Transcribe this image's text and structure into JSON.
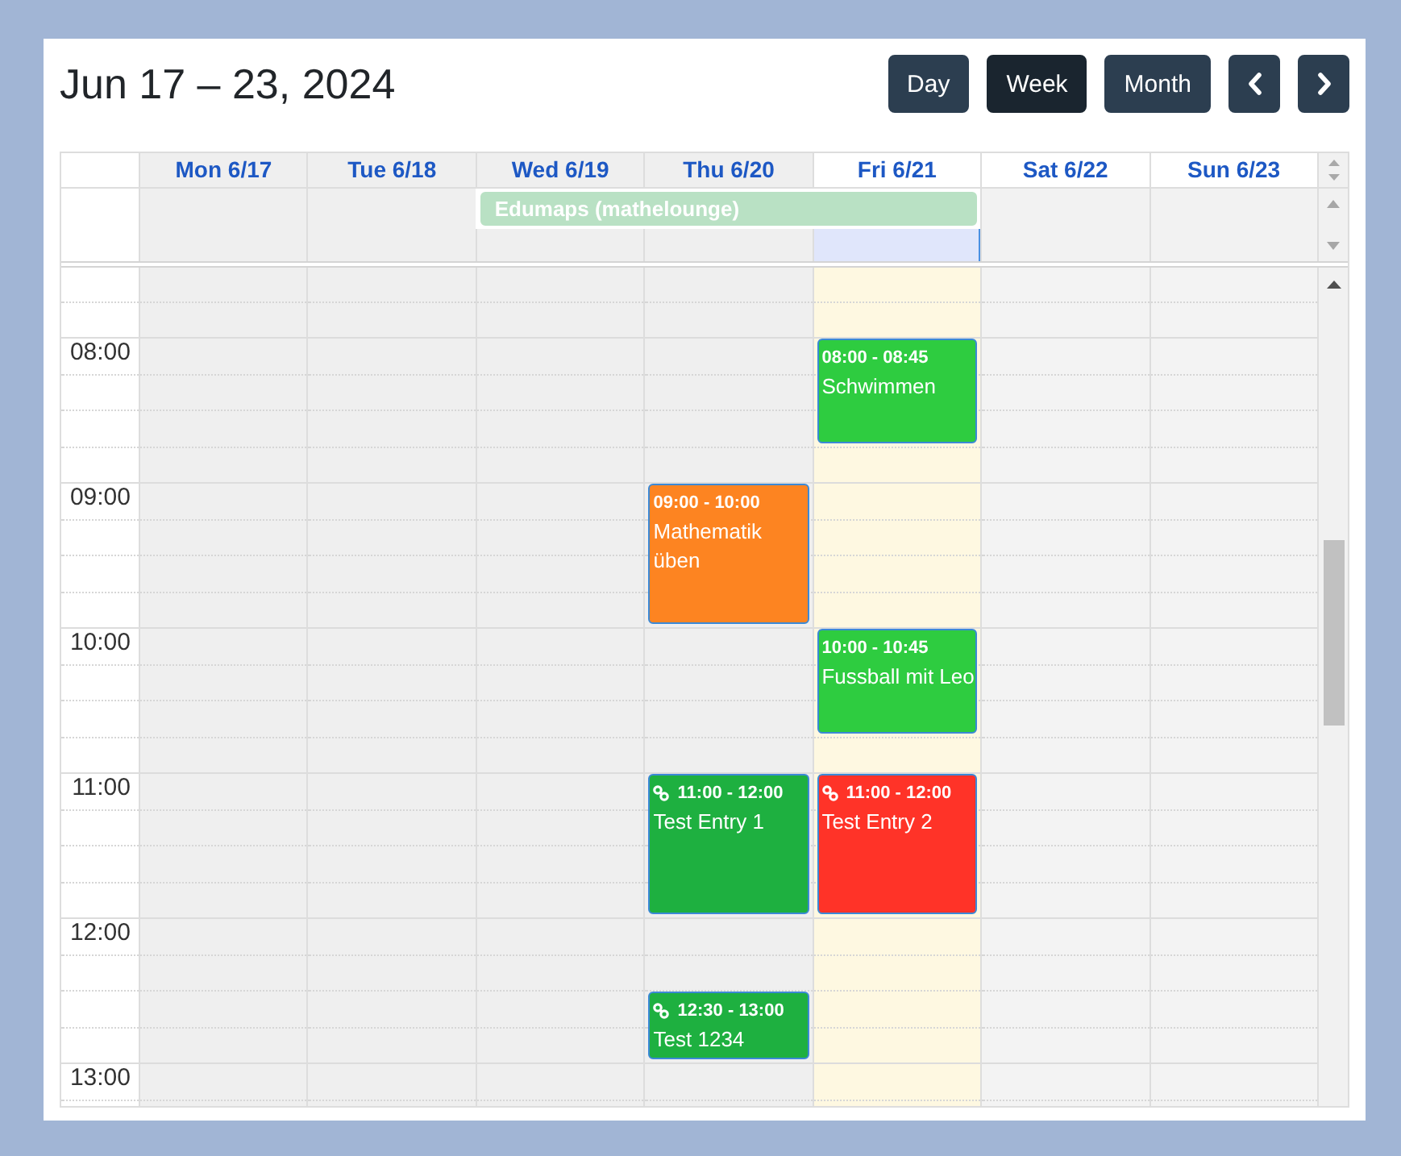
{
  "title": "Jun 17 – 23, 2024",
  "views": [
    {
      "label": "Day",
      "selected": false
    },
    {
      "label": "Week",
      "selected": true
    },
    {
      "label": "Month",
      "selected": false
    }
  ],
  "days": [
    {
      "label": "Mon 6/17",
      "past": true,
      "today": false
    },
    {
      "label": "Tue 6/18",
      "past": true,
      "today": false
    },
    {
      "label": "Wed 6/19",
      "past": true,
      "today": false,
      "all_day": {
        "kind": "start",
        "title": "Edumaps (mathelounge)",
        "color": "#b9e1c4"
      }
    },
    {
      "label": "Thu 6/20",
      "past": true,
      "today": false,
      "all_day": {
        "kind": "middle"
      },
      "events": [
        {
          "time": "09:00 - 10:00",
          "title": "Mathematik üben",
          "color": "#fd8421",
          "linked": false
        },
        {
          "time": "11:00 - 12:00",
          "title": "Test Entry 1",
          "color": "#1eb040",
          "linked": true
        },
        {
          "time": "12:30 - 13:00",
          "title": "Test 1234",
          "color": "#1eb040",
          "linked": true
        }
      ]
    },
    {
      "label": "Fri 6/21",
      "past": false,
      "today": true,
      "all_day": {
        "kind": "end"
      },
      "events": [
        {
          "time": "08:00 - 08:45",
          "title": "Schwimmen",
          "color": "#2ecc40",
          "linked": false
        },
        {
          "time": "10:00 - 10:45",
          "title": "Fussball mit Leo",
          "color": "#2ecc40",
          "linked": false
        },
        {
          "time": "11:00 - 12:00",
          "title": "Test Entry 2",
          "color": "#ff3328",
          "linked": true
        }
      ]
    },
    {
      "label": "Sat 6/22",
      "past": false,
      "today": false
    },
    {
      "label": "Sun 6/23",
      "past": false,
      "today": false
    }
  ],
  "time_labels": [
    "08:00",
    "09:00",
    "10:00",
    "11:00",
    "12:00",
    "13:00"
  ]
}
